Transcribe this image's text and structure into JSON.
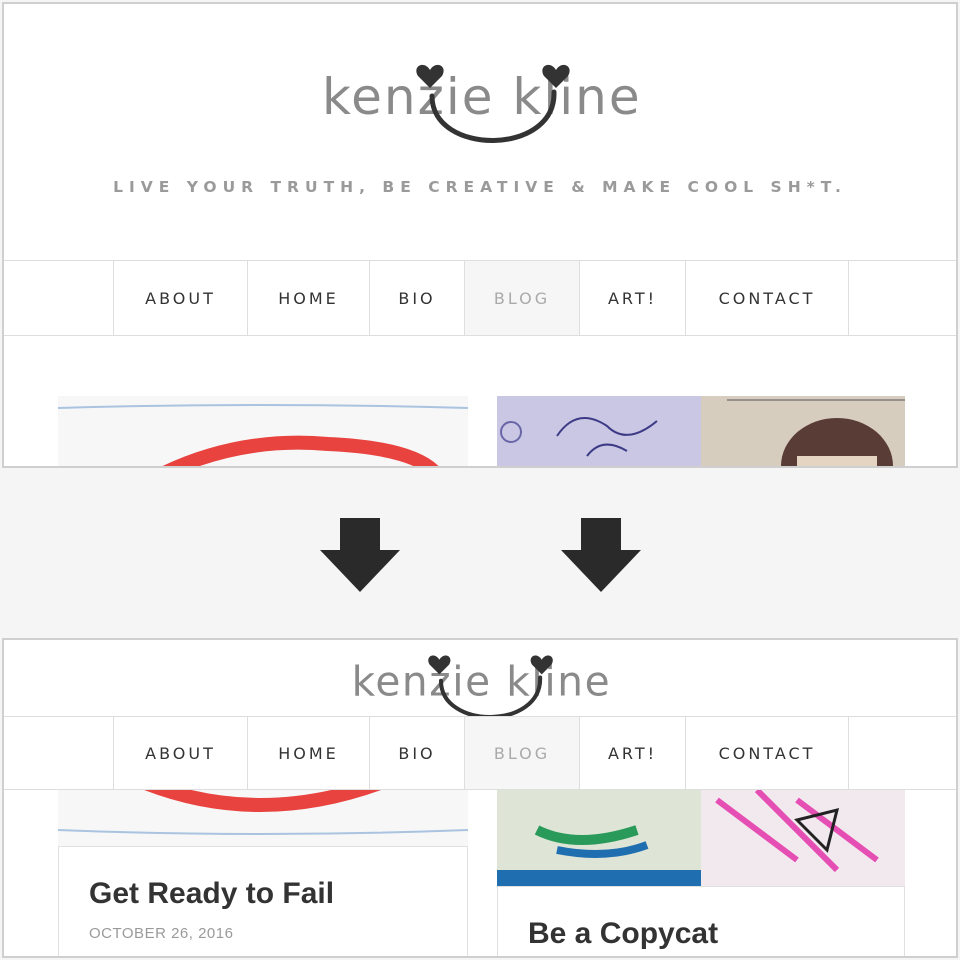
{
  "site": {
    "logo_text": "kenzie kline",
    "tagline": "LIVE YOUR TRUTH, BE CREATIVE & MAKE COOL SH*T."
  },
  "nav": [
    {
      "label": "ABOUT",
      "active": false
    },
    {
      "label": "HOME",
      "active": false
    },
    {
      "label": "BIO",
      "active": false
    },
    {
      "label": "BLOG",
      "active": true
    },
    {
      "label": "ART!",
      "active": false
    },
    {
      "label": "CONTACT",
      "active": false
    }
  ],
  "posts": [
    {
      "title": "Get Ready to Fail",
      "date": "OCTOBER 26, 2016",
      "thumb": "red-marker-circle-drawing"
    },
    {
      "title": "Be a Copycat",
      "date": "",
      "thumb": "doodle-sketches-collage"
    }
  ],
  "icons": {
    "scroll_arrow": "arrow-down-icon"
  },
  "colors": {
    "accent_red": "#e8433f",
    "nav_active_bg": "#f6f6f6",
    "text_dark": "#333333",
    "text_muted": "#9a9a9a"
  }
}
